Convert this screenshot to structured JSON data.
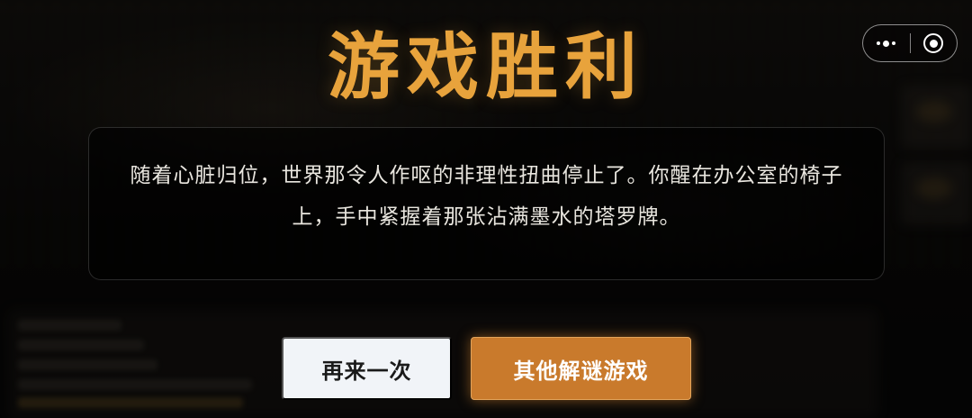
{
  "title": "游戏胜利",
  "message": "随着心脏归位，世界那令人作呕的非理性扭曲停止了。你醒在办公室的椅子上，手中紧握着那张沾满墨水的塔罗牌。",
  "buttons": {
    "retry": "再来一次",
    "other_games": "其他解谜游戏"
  },
  "capsule": {
    "more_icon": "more-dots-icon",
    "close_icon": "close-target-icon"
  },
  "colors": {
    "title": "#e8a33c",
    "primary_button": "#c97a2c",
    "secondary_button": "#f1f4f8",
    "background": "#070707"
  }
}
